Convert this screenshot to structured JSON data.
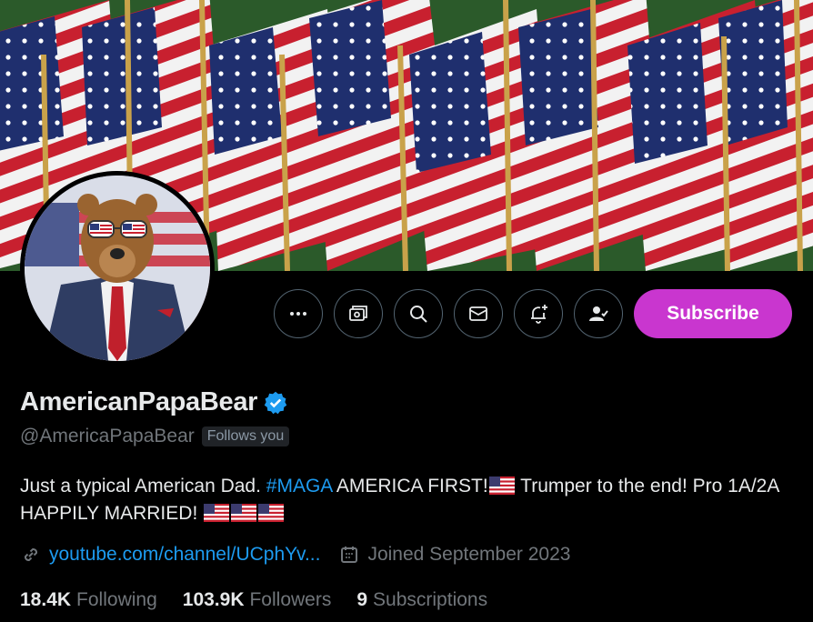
{
  "profile": {
    "display_name": "AmericanPapaBear",
    "handle": "@AmericaPapaBear",
    "follows_you": "Follows you",
    "bio": {
      "part1": "Just a typical American Dad. ",
      "hashtag": "#MAGA",
      "part2": " AMERICA FIRST!",
      "part3": " Trumper to the end! Pro 1A/2A HAPPILY MARRIED! "
    },
    "link": "youtube.com/channel/UCphYv...",
    "joined": "Joined September 2023"
  },
  "stats": {
    "following_count": "18.4K",
    "following_label": "Following",
    "followers_count": "103.9K",
    "followers_label": "Followers",
    "subscriptions_count": "9",
    "subscriptions_label": "Subscriptions"
  },
  "actions": {
    "subscribe_label": "Subscribe",
    "icons": [
      "more-icon",
      "money-icon",
      "search-icon",
      "message-icon",
      "notification-add-icon",
      "following-check-icon"
    ]
  },
  "colors": {
    "accent": "#1d9bf0",
    "subscribe": "#c936cf",
    "background": "#000000",
    "muted": "#71767b"
  }
}
